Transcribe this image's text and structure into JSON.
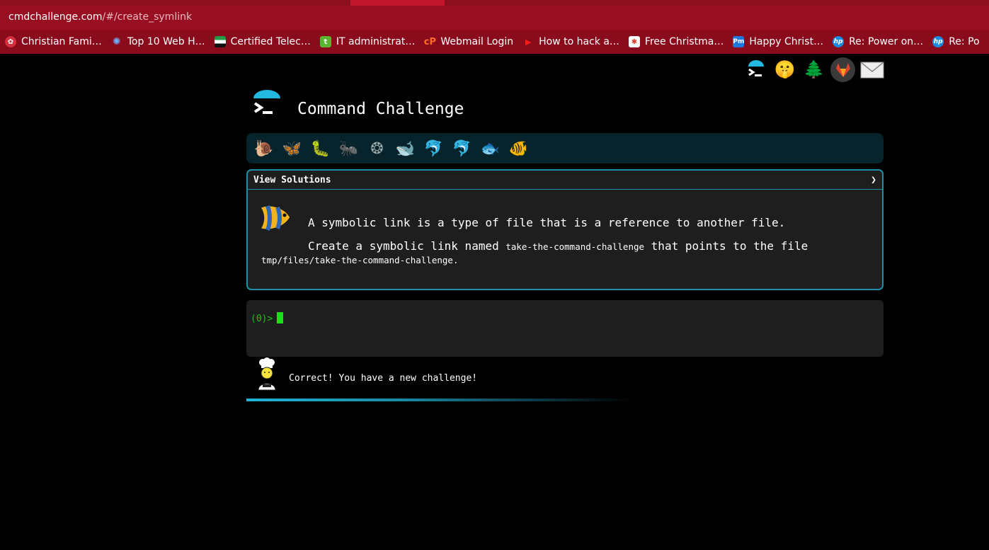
{
  "browser": {
    "url_host": "cmdchallenge.com",
    "url_path": "/#/create_symlink",
    "bookmarks": [
      {
        "label": "Christian Fami…",
        "icon": "globe-icon",
        "color": "#d3303f"
      },
      {
        "label": "Top 10 Web H…",
        "icon": "gear-icon",
        "color": "#3b8fe0"
      },
      {
        "label": "Certified Telec…",
        "icon": "flag-icon",
        "color": "#1f9d46"
      },
      {
        "label": "IT administrat…",
        "icon": "t-icon",
        "color": "#5cb531"
      },
      {
        "label": "Webmail Login",
        "icon": "cp-icon",
        "color": "#ff6c2c"
      },
      {
        "label": "How to hack a…",
        "icon": "play-icon",
        "color": "#ff0000"
      },
      {
        "label": "Free Christma…",
        "icon": "ornament-icon",
        "color": "#e23d2c"
      },
      {
        "label": "Happy Christ…",
        "icon": "pm-icon",
        "color": "#2277dd"
      },
      {
        "label": "Re: Power on…",
        "icon": "hp-icon",
        "color": "#1c8ce3"
      },
      {
        "label": "Re: Po",
        "icon": "hp-icon",
        "color": "#1c8ce3"
      }
    ]
  },
  "page": {
    "title": "Command Challenge",
    "header_icons": [
      "terminal-logo-icon",
      "shushing-face-icon",
      "tree-icon",
      "gitlab-icon",
      "mail-icon"
    ],
    "levels": [
      "snail-icon",
      "butterfly-icon",
      "caterpillar-icon",
      "ant-icon",
      "web-icon",
      "whale-icon",
      "dolphin-icon",
      "dolphin-icon",
      "fish-icon",
      "tropical-fish-icon"
    ],
    "solutions_label": "View Solutions",
    "solutions_chevron": "❯",
    "desc_line1": "A symbolic link is a type of file that is a reference to another file.",
    "desc_line2_prefix": "Create a symbolic link named",
    "desc_code1": "take-the-command-challenge",
    "desc_line2_suffix": "that points to the file",
    "desc_code2": "tmp/files/take-the-command-challenge",
    "desc_end": ".",
    "prompt": "(0)>",
    "status_message": "Correct! You have a new challenge!",
    "accent": "#1f8fa8"
  }
}
